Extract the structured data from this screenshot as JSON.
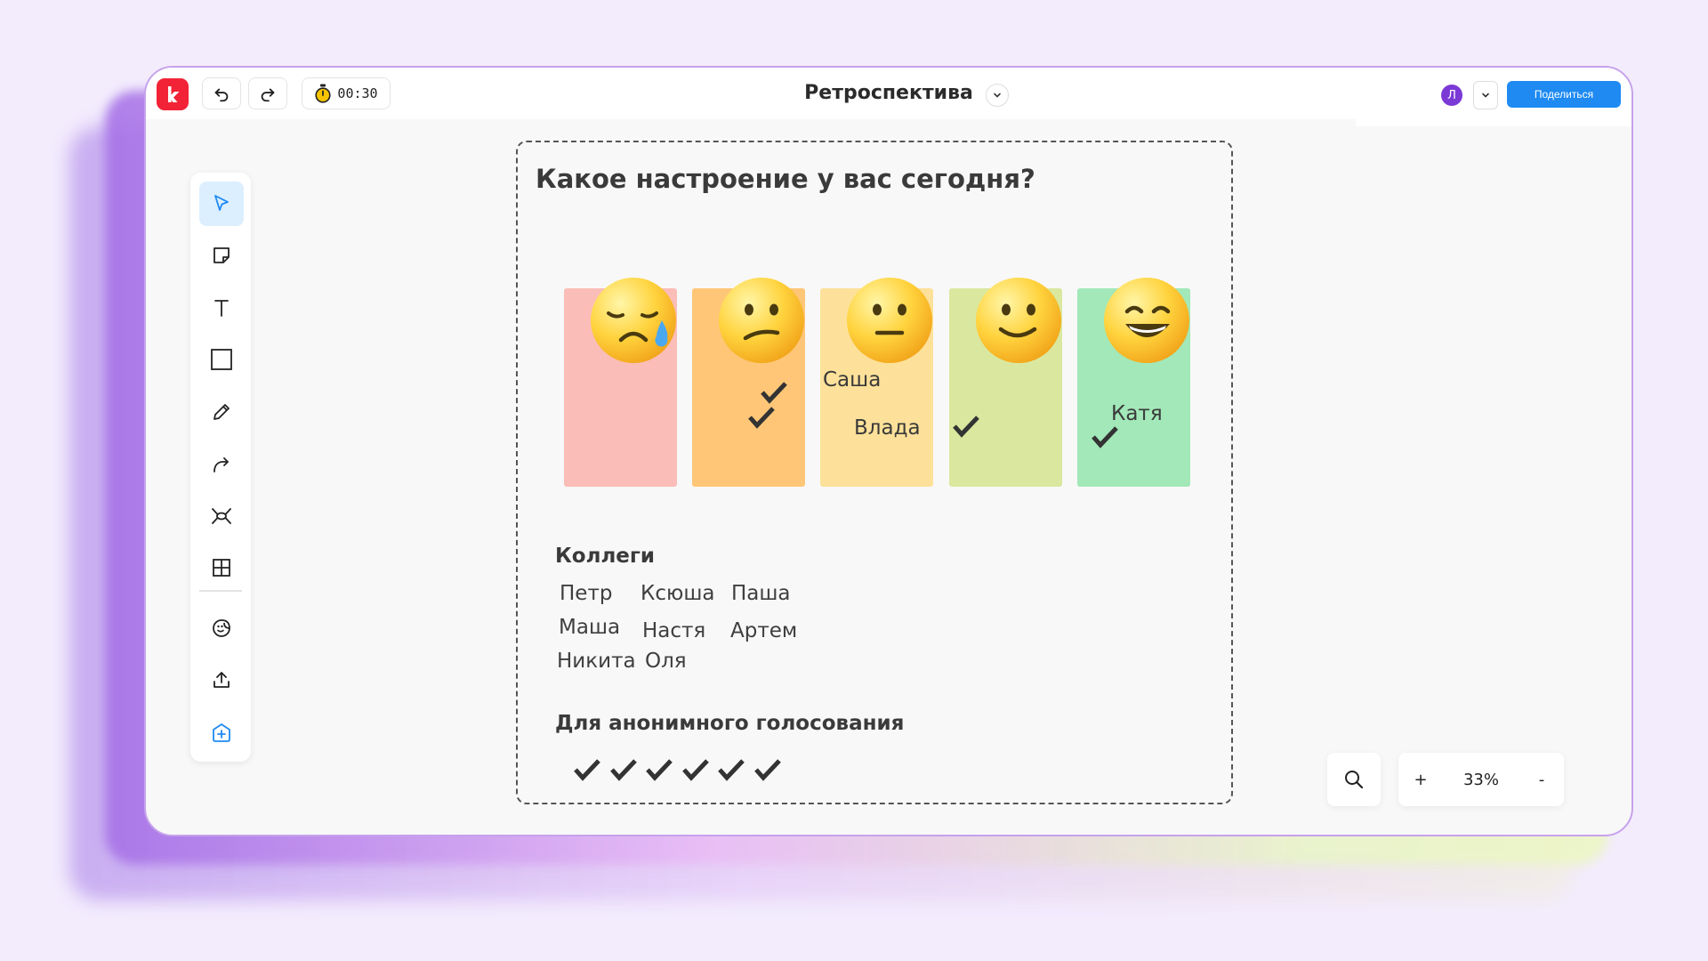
{
  "header": {
    "timer": "00:30",
    "board_title": "Ретроспектива",
    "avatar_initial": "Л",
    "share_label": "Поделиться"
  },
  "toolbar": {
    "tools": [
      "select-tool",
      "sticky-note-tool",
      "text-tool",
      "rectangle-tool",
      "pen-tool",
      "connector-tool",
      "mind-map-tool",
      "table-tool",
      "stickers-tool",
      "upload-tool",
      "add-app-tool"
    ],
    "active": "select-tool"
  },
  "frame": {
    "title": "Какое настроение у вас сегодня?",
    "mood_votes": {
      "neutral_names": [
        "Саша",
        "Влада"
      ],
      "happy_name": "Катя"
    },
    "colleagues_title": "Коллеги",
    "colleagues": [
      "Петр",
      "Ксюша",
      "Паша",
      "Маша",
      "Настя",
      "Артем",
      "Никита",
      "Оля"
    ],
    "anonymous_title": "Для анонимного голосования",
    "anonymous_check_count": 6
  },
  "sticky_colors": [
    "#fbbdb7",
    "#ffc677",
    "#fde19a",
    "#dae89f",
    "#a2e8b8"
  ],
  "accent_colors": {
    "logo": "#f22336",
    "share": "#1e8af2",
    "avatar": "#7b39d6"
  },
  "zoom": {
    "plus": "+",
    "level": "33%",
    "minus": "-"
  }
}
